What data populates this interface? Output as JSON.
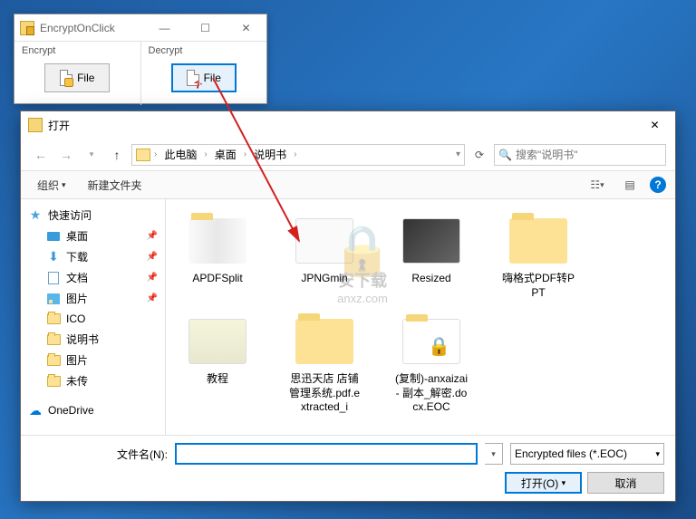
{
  "app": {
    "title": "EncryptOnClick",
    "sections": {
      "encrypt": {
        "label": "Encrypt",
        "button": "File"
      },
      "decrypt": {
        "label": "Decrypt",
        "button": "File"
      }
    }
  },
  "dialog": {
    "title": "打开",
    "path": [
      "此电脑",
      "桌面",
      "说明书"
    ],
    "search_placeholder": "搜索\"说明书\"",
    "toolbar": {
      "organize": "组织",
      "newfolder": "新建文件夹"
    },
    "sidebar": {
      "quick": "快速访问",
      "items": [
        {
          "label": "桌面",
          "pin": true,
          "icon": "desktop"
        },
        {
          "label": "下载",
          "pin": true,
          "icon": "download"
        },
        {
          "label": "文档",
          "pin": true,
          "icon": "doc"
        },
        {
          "label": "图片",
          "pin": true,
          "icon": "pic"
        },
        {
          "label": "ICO",
          "pin": false,
          "icon": "folder"
        },
        {
          "label": "说明书",
          "pin": false,
          "icon": "folder"
        },
        {
          "label": "图片",
          "pin": false,
          "icon": "folder"
        },
        {
          "label": "未传",
          "pin": false,
          "icon": "folder"
        }
      ],
      "onedrive": "OneDrive"
    },
    "files": [
      {
        "name": "APDFSplit",
        "type": "folder-preview"
      },
      {
        "name": "JPNGmin",
        "type": "folder-preview"
      },
      {
        "name": "Resized",
        "type": "folder-preview"
      },
      {
        "name": "嗨格式PDF转PPT",
        "type": "folder"
      },
      {
        "name": "教程",
        "type": "folder-preview"
      },
      {
        "name": "思迅天店 店铺管理系统.pdf.extracted_i",
        "type": "folder"
      },
      {
        "name": "(复制)-anxaizai - 副本_解密.docx.EOC",
        "type": "locked"
      }
    ],
    "filename_label": "文件名(N):",
    "filename_value": "",
    "filter": "Encrypted files (*.EOC)",
    "open_btn": "打开(O)",
    "cancel_btn": "取消"
  },
  "watermark": {
    "text": "安下载",
    "url": "anxz.com"
  }
}
